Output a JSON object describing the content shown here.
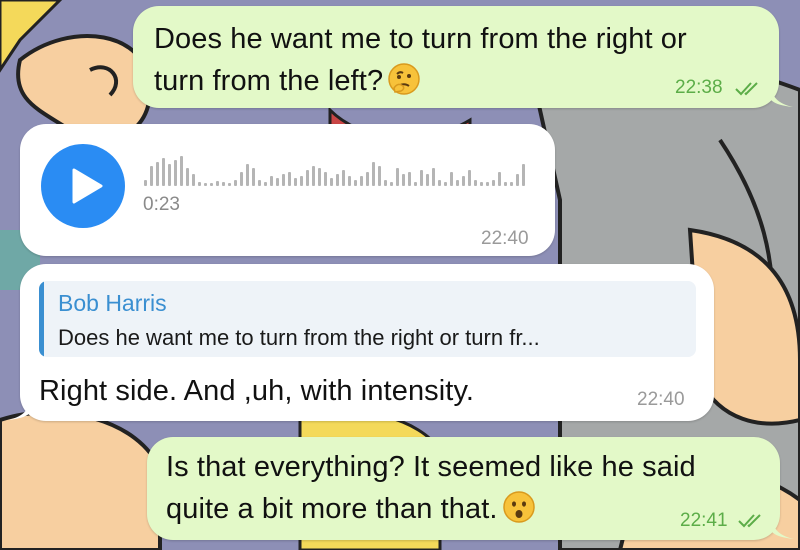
{
  "chat": {
    "messages": [
      {
        "direction": "outgoing",
        "lines": [
          "Does he want me to turn from the right or",
          "turn from the left?"
        ],
        "emoji": "thinking-face",
        "time": "22:38",
        "status": "read"
      },
      {
        "direction": "incoming",
        "type": "voice",
        "duration": "0:23",
        "time": "22:40"
      },
      {
        "direction": "incoming",
        "reply_to": {
          "author": "Bob Harris",
          "text": "Does he want me to turn from the right or turn fr..."
        },
        "text": "Right side. And ,uh, with intensity.",
        "time": "22:40"
      },
      {
        "direction": "outgoing",
        "lines": [
          "Is that everything? It seemed like he said",
          "quite a bit more than that."
        ],
        "emoji": "hushed-face",
        "time": "22:41",
        "status": "read"
      }
    ]
  },
  "colors": {
    "outgoing_bubble": "#e3f9c8",
    "incoming_bubble": "#ffffff",
    "accent_blue": "#2a8cf3",
    "read_check_green": "#5cad48",
    "reply_author": "#3a8fd1"
  }
}
